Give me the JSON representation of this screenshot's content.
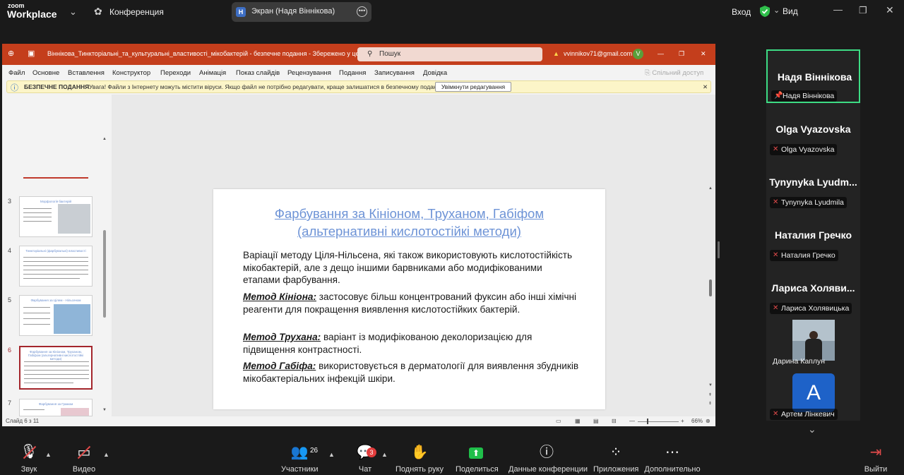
{
  "zoom": {
    "logo_small": "zoom",
    "logo_big": "Workplace",
    "meeting_label": "Конференция",
    "share_badge": "Н",
    "share_label": "Экран (Надя Віннікова)",
    "signin_label": "Вход",
    "view_label": "Вид",
    "security_color": "#2fbf4b"
  },
  "ppt": {
    "title": "Віннікова_Тинкторіальні_та_культуральні_властивості_мікобактерій  -  безпечне подання  -  Збережено у цей ПК",
    "search_placeholder": "Пошук",
    "account": "vvinnikov71@gmail.com",
    "avatar_letter": "V",
    "menu": [
      "Файл",
      "Основне",
      "Вставлення",
      "Конструктор",
      "Переходи",
      "Анімація",
      "Показ слайдів",
      "Рецензування",
      "Подання",
      "Записування",
      "Довідка"
    ],
    "share_label": "Спільний доступ",
    "warning_title": "БЕЗПЕЧНЕ ПОДАННЯ",
    "warning_text": "Увага! Файли з Інтернету можуть містити віруси. Якщо файл не потрібно редагувати, краще залишатися в безпечному поданні.",
    "warning_button": "Увімкнути редагування",
    "thumbs": [
      {
        "num": "3",
        "title": "Морфологія бактерій"
      },
      {
        "num": "4",
        "title": "Тинкторіальні (фарбувальні) властивості"
      },
      {
        "num": "5",
        "title": "Фарбування за Цілем - Нільсеном"
      },
      {
        "num": "6",
        "title": "Фарбування за Кініоном, Труханом, Габіфом (альтернативні кислотостійкі методи)"
      },
      {
        "num": "7",
        "title": "Фарбування за Грамом"
      }
    ],
    "slide": {
      "title_line1": "Фарбування за Кініоном, Труханом, Габіфом",
      "title_line2": "(альтернативні кислотостійкі методи)",
      "intro": "Варіації методу Ціля-Нільсена, які також використовують кислотостійкість мікобактерій, але з дещо іншими барвниками або модифікованими етапами фарбування.",
      "m1_name": "Метод Кініона:",
      "m1_text": " застосовує більш концентрований фуксин або інші хімічні реагенти для покращення виявлення кислотостійких бактерій.",
      "m2_name": "Метод Трухана:",
      "m2_text": " варіант із модифікованою деколоризацією для підвищення контрастності.",
      "m3_name": "Метод Габіфа:",
      "m3_text": " використовується в дерматології для виявлення збудників мікобактеріальних інфекцій шкіри."
    },
    "status_slide": "Слайд 6 з 11",
    "zoom_level": "66%",
    "accent": "#c43e1c"
  },
  "participants": [
    {
      "name": "Надя Віннікова",
      "label": "Надя Віннікова",
      "muted": false,
      "active": true
    },
    {
      "name": "Olga Vyazovska",
      "label": "Olga Vyazovska",
      "muted": true
    },
    {
      "name": "Tynynyka Lyudm...",
      "label": "Tynynyka Lyudmila",
      "muted": true
    },
    {
      "name": "Наталия Гречко",
      "label": "Наталия Гречко",
      "muted": true
    },
    {
      "name": "Лариса Холяви...",
      "label": "Лариса Холявицька",
      "muted": true
    },
    {
      "name": "",
      "label": "Дарина Каплун",
      "muted": false
    },
    {
      "name": "А",
      "label": "Артем Лінкевич",
      "muted": true
    }
  ],
  "toolbar": {
    "audio": "Звук",
    "video": "Видео",
    "participants": "Участники",
    "participants_count": "26",
    "chat": "Чат",
    "chat_badge": "3",
    "raise_hand": "Поднять руку",
    "share": "Поделиться",
    "meeting_data": "Данные конференции",
    "apps": "Приложения",
    "more": "Дополнительно",
    "leave": "Выйти"
  }
}
